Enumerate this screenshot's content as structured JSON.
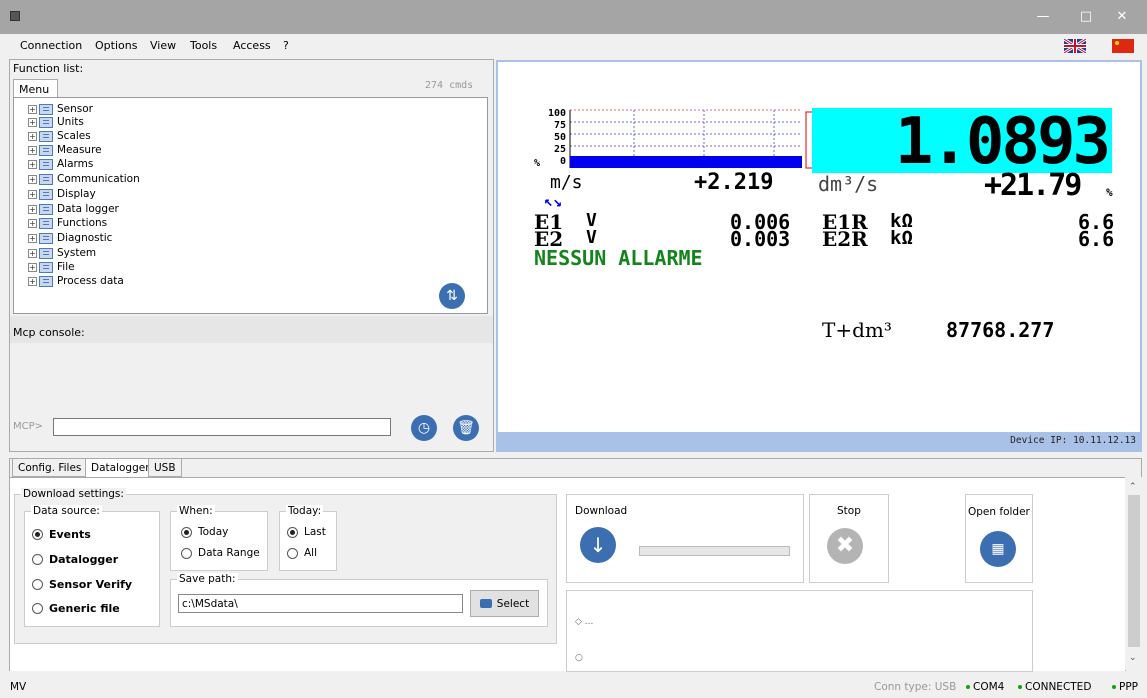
{
  "menubar": {
    "items": [
      "Connection",
      "Options",
      "View",
      "Tools",
      "Access",
      "?"
    ]
  },
  "function_list": {
    "label": "Function list:",
    "tab": "Menu",
    "count": "274 cmds",
    "items": [
      "Sensor",
      "Units",
      "Scales",
      "Measure",
      "Alarms",
      "Communication",
      "Display",
      "Data logger",
      "Functions",
      "Diagnostic",
      "System",
      "File",
      "Process data"
    ]
  },
  "console": {
    "label": "Mcp console:",
    "prompt": "MCP>",
    "input_value": ""
  },
  "device_display": {
    "bar_scale": [
      "100",
      "75",
      "50",
      "25",
      "0"
    ],
    "percent_sign": "%",
    "big_value": "1.0893",
    "flow_unit": "m/s",
    "flow_value": "+2.219",
    "vol_unit": "dm³/s",
    "percent_value": "+21.79",
    "percent_unit": "%",
    "e1_label": "E1",
    "e1_unit": "V",
    "e1_value": "0.006",
    "e1r_label": "E1R",
    "e1r_unit": "kΩ",
    "e1r_value": "6.6",
    "e2_label": "E2",
    "e2_unit": "V",
    "e2_value": "0.003",
    "e2r_label": "E2R",
    "e2r_unit": "kΩ",
    "e2r_value": "6.6",
    "alarm_text": "NESSUN ALLARME",
    "totalizer_label": "T+dm³",
    "totalizer_value": "87768.277",
    "device_ip": "Device IP: 10.11.12.13"
  },
  "bottom_tabs": [
    "Config. Files",
    "Datalogger",
    "USB"
  ],
  "download_settings": {
    "label": "Download settings:",
    "data_source_label": "Data source:",
    "data_sources": [
      "Events",
      "Datalogger",
      "Sensor Verify",
      "Generic file"
    ],
    "data_source_selected": "Events",
    "when_label": "When:",
    "when_options": [
      "Today",
      "Data Range"
    ],
    "when_selected": "Today",
    "today_label": "Today:",
    "today_options": [
      "Last",
      "All"
    ],
    "today_selected": "Last",
    "save_path_label": "Save path:",
    "save_path_value": "c:\\MSdata\\",
    "select_button": "Select"
  },
  "actions": {
    "download": "Download",
    "stop": "Stop",
    "open_folder": "Open folder",
    "download_progress": 0
  },
  "log": [
    "◇ ...",
    "○"
  ],
  "status": {
    "left": "MV",
    "conn_type": "Conn type: USB",
    "com": "COM4",
    "connected": "CONNECTED",
    "ppp": "PPP"
  },
  "colors": {
    "big_value_bg": "#00ffff",
    "alarm_text": "#15841d",
    "status_dot": "#13a10e",
    "accent_blue": "#3c6fb2"
  }
}
